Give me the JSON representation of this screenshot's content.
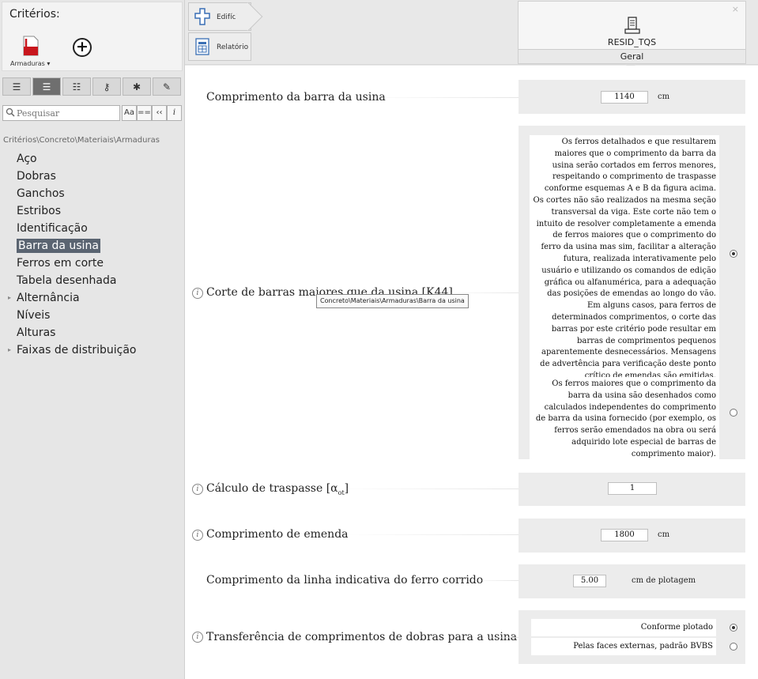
{
  "left": {
    "criteria_title": "Critérios:",
    "armaduras_label": "Armaduras ▾",
    "add_label": "+",
    "search_placeholder": "Pesquisar",
    "search_buttons": [
      "Aa",
      "==",
      "‹‹",
      "i"
    ],
    "breadcrumb": "Critérios\\Concreto\\Materiais\\Armaduras",
    "tree": [
      {
        "label": "Aço"
      },
      {
        "label": "Dobras"
      },
      {
        "label": "Ganchos"
      },
      {
        "label": "Estribos"
      },
      {
        "label": "Identificação"
      },
      {
        "label": "Barra da usina",
        "selected": true
      },
      {
        "label": "Ferros em corte"
      },
      {
        "label": "Tabela desenhada"
      },
      {
        "label": "Alternância",
        "expandable": true
      },
      {
        "label": "Níveis"
      },
      {
        "label": "Alturas"
      },
      {
        "label": "Faixas de distribuição",
        "expandable": true
      }
    ]
  },
  "topbar": {
    "edificio": "Edifício",
    "relatorio": "Relatório",
    "resid_name": "RESID_TQS",
    "resid_tab": "Geral",
    "close": "×"
  },
  "rows": {
    "comp_barra": {
      "label": "Comprimento da barra da usina",
      "value": "1140",
      "unit": "cm"
    },
    "corte": {
      "label": "Corte de barras maiores que da usina [K44]",
      "option1": "Os ferros detalhados e que resultarem maiores que o comprimento da barra da usina serão cortados em ferros menores, respeitando o comprimento de traspasse conforme esquemas A e B da figura acima. Os cortes não são realizados na mesma seção transversal da viga. Este corte não tem o intuito de resolver completamente a emenda de ferros maiores que o comprimento do ferro da usina mas sim, facilitar a alteração futura, realizada interativamente pelo usuário e utilizando os comandos de edição gráfica ou alfanumérica, para a adequação das posições de emendas ao longo do vão. Em alguns casos, para ferros de determinados comprimentos, o corte das barras por este critério pode resultar em barras de comprimentos pequenos aparentemente desnecessários. Mensagens de advertência para verificação deste ponto crítico de emendas são emitidas.",
      "option2": "Os ferros maiores que o comprimento da barra da usina são desenhados como calculados independentes do comprimento de barra da usina fornecido (por exemplo, os ferros serão emendados na obra ou será adquirido lote especial de barras de comprimento maior).",
      "tooltip": "Concreto\\Materiais\\Armaduras\\Barra da usina"
    },
    "traspasse": {
      "label": "Cálculo de traspasse [α",
      "sub": "ot",
      "label_end": "]",
      "value": "1"
    },
    "emenda": {
      "label": "Comprimento de emenda",
      "value": "1800",
      "unit": "cm"
    },
    "linha": {
      "label": "Comprimento da linha indicativa do ferro corrido",
      "value": "5.00",
      "unit": "cm  de plotagem"
    },
    "transf": {
      "label": "Transferência de comprimentos de dobras para a usina",
      "option1": "Conforme plotado",
      "option2": "Pelas faces externas, padrão BVBS"
    }
  }
}
